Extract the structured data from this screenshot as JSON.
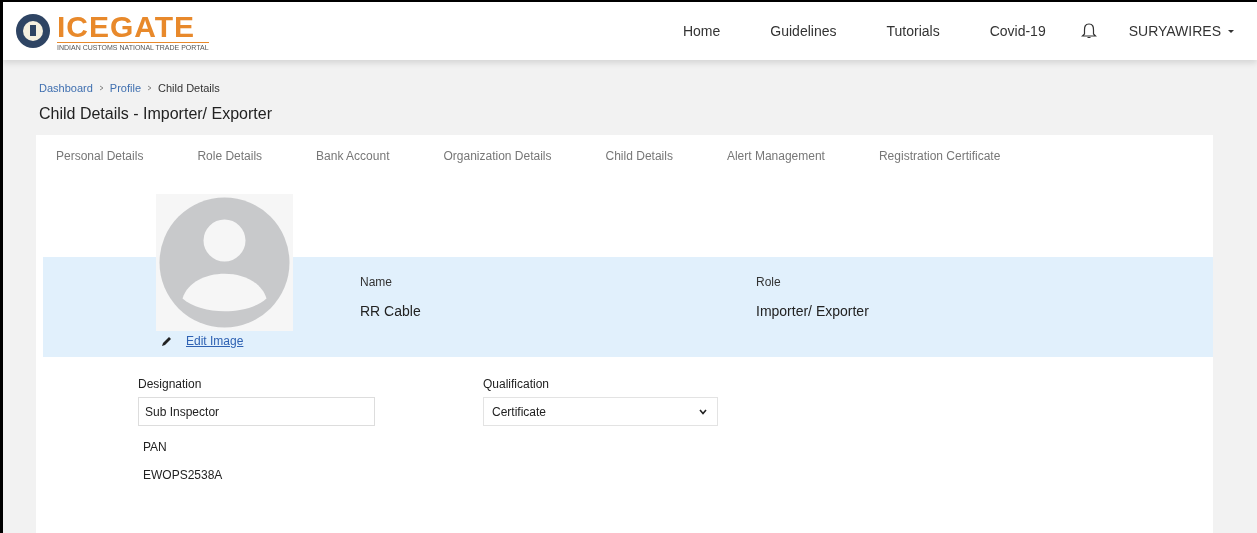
{
  "header": {
    "logo": {
      "name": "ICEGATE",
      "tagline": "INDIAN CUSTOMS NATIONAL TRADE PORTAL"
    },
    "nav": [
      {
        "label": "Home"
      },
      {
        "label": "Guidelines"
      },
      {
        "label": "Tutorials"
      },
      {
        "label": "Covid-19"
      }
    ],
    "user_menu": {
      "label": "SURYAWIRES"
    }
  },
  "breadcrumb": [
    {
      "label": "Dashboard",
      "link": true
    },
    {
      "label": "Profile",
      "link": true
    },
    {
      "label": "Child Details",
      "link": false
    }
  ],
  "page_title": "Child Details - Importer/ Exporter",
  "tabs": [
    {
      "label": "Personal Details",
      "selected": false
    },
    {
      "label": "Role Details",
      "selected": false
    },
    {
      "label": "Bank Account",
      "selected": false
    },
    {
      "label": "Organization Details",
      "selected": false
    },
    {
      "label": "Child Details",
      "selected": false
    },
    {
      "label": "Alert Management",
      "selected": false
    },
    {
      "label": "Registration Certificate",
      "selected": false
    }
  ],
  "profile": {
    "edit_image": "Edit Image",
    "fields": [
      {
        "label": "Name",
        "value": "RR Cable"
      },
      {
        "label": "Role",
        "value": "Importer/ Exporter"
      }
    ]
  },
  "form": {
    "designation": {
      "label": "Designation",
      "value": "Sub Inspector"
    },
    "qualification": {
      "label": "Qualification",
      "value": "Certificate"
    },
    "pan": {
      "label": "PAN",
      "value": "EWOPS2538A"
    }
  }
}
